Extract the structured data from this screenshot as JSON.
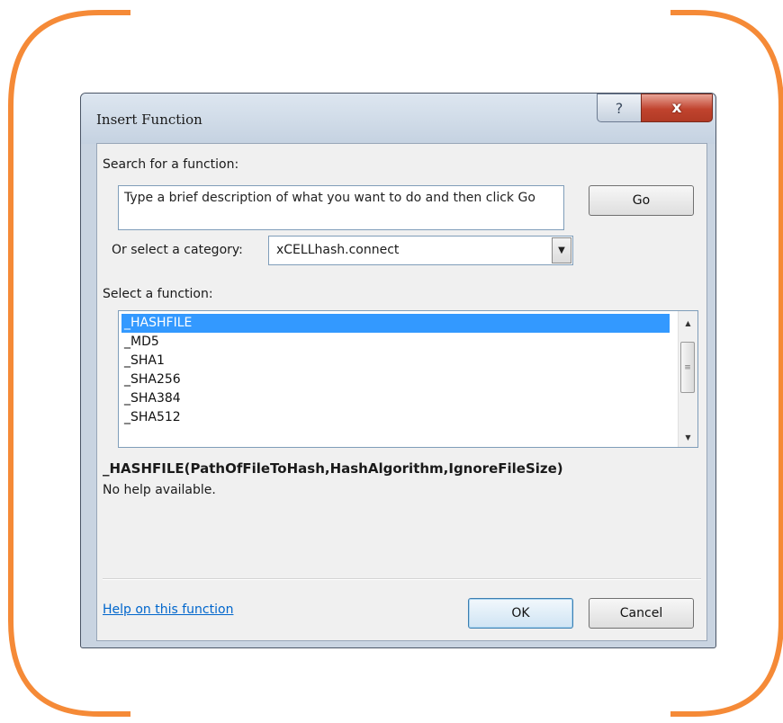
{
  "window": {
    "title": "Insert Function",
    "help_glyph": "?",
    "close_glyph": "x"
  },
  "search": {
    "label": "Search for a function:",
    "value": "Type a brief description of what you want to do and then click Go",
    "go_label": "Go"
  },
  "category": {
    "label": "Or select a category:",
    "value": "xCELLhash.connect"
  },
  "functions": {
    "label": "Select a function:",
    "items": [
      "_HASHFILE",
      "_MD5",
      "_SHA1",
      "_SHA256",
      "_SHA384",
      "_SHA512"
    ],
    "selected": "_HASHFILE"
  },
  "details": {
    "signature": "_HASHFILE(PathOfFileToHash,HashAlgorithm,IgnoreFileSize)",
    "description": "No help available."
  },
  "footer": {
    "help_link": "Help on this function",
    "ok_label": "OK",
    "cancel_label": "Cancel"
  },
  "colors": {
    "frame_accent": "#f58a37",
    "selection": "#3399ff",
    "link": "#0066cc"
  }
}
